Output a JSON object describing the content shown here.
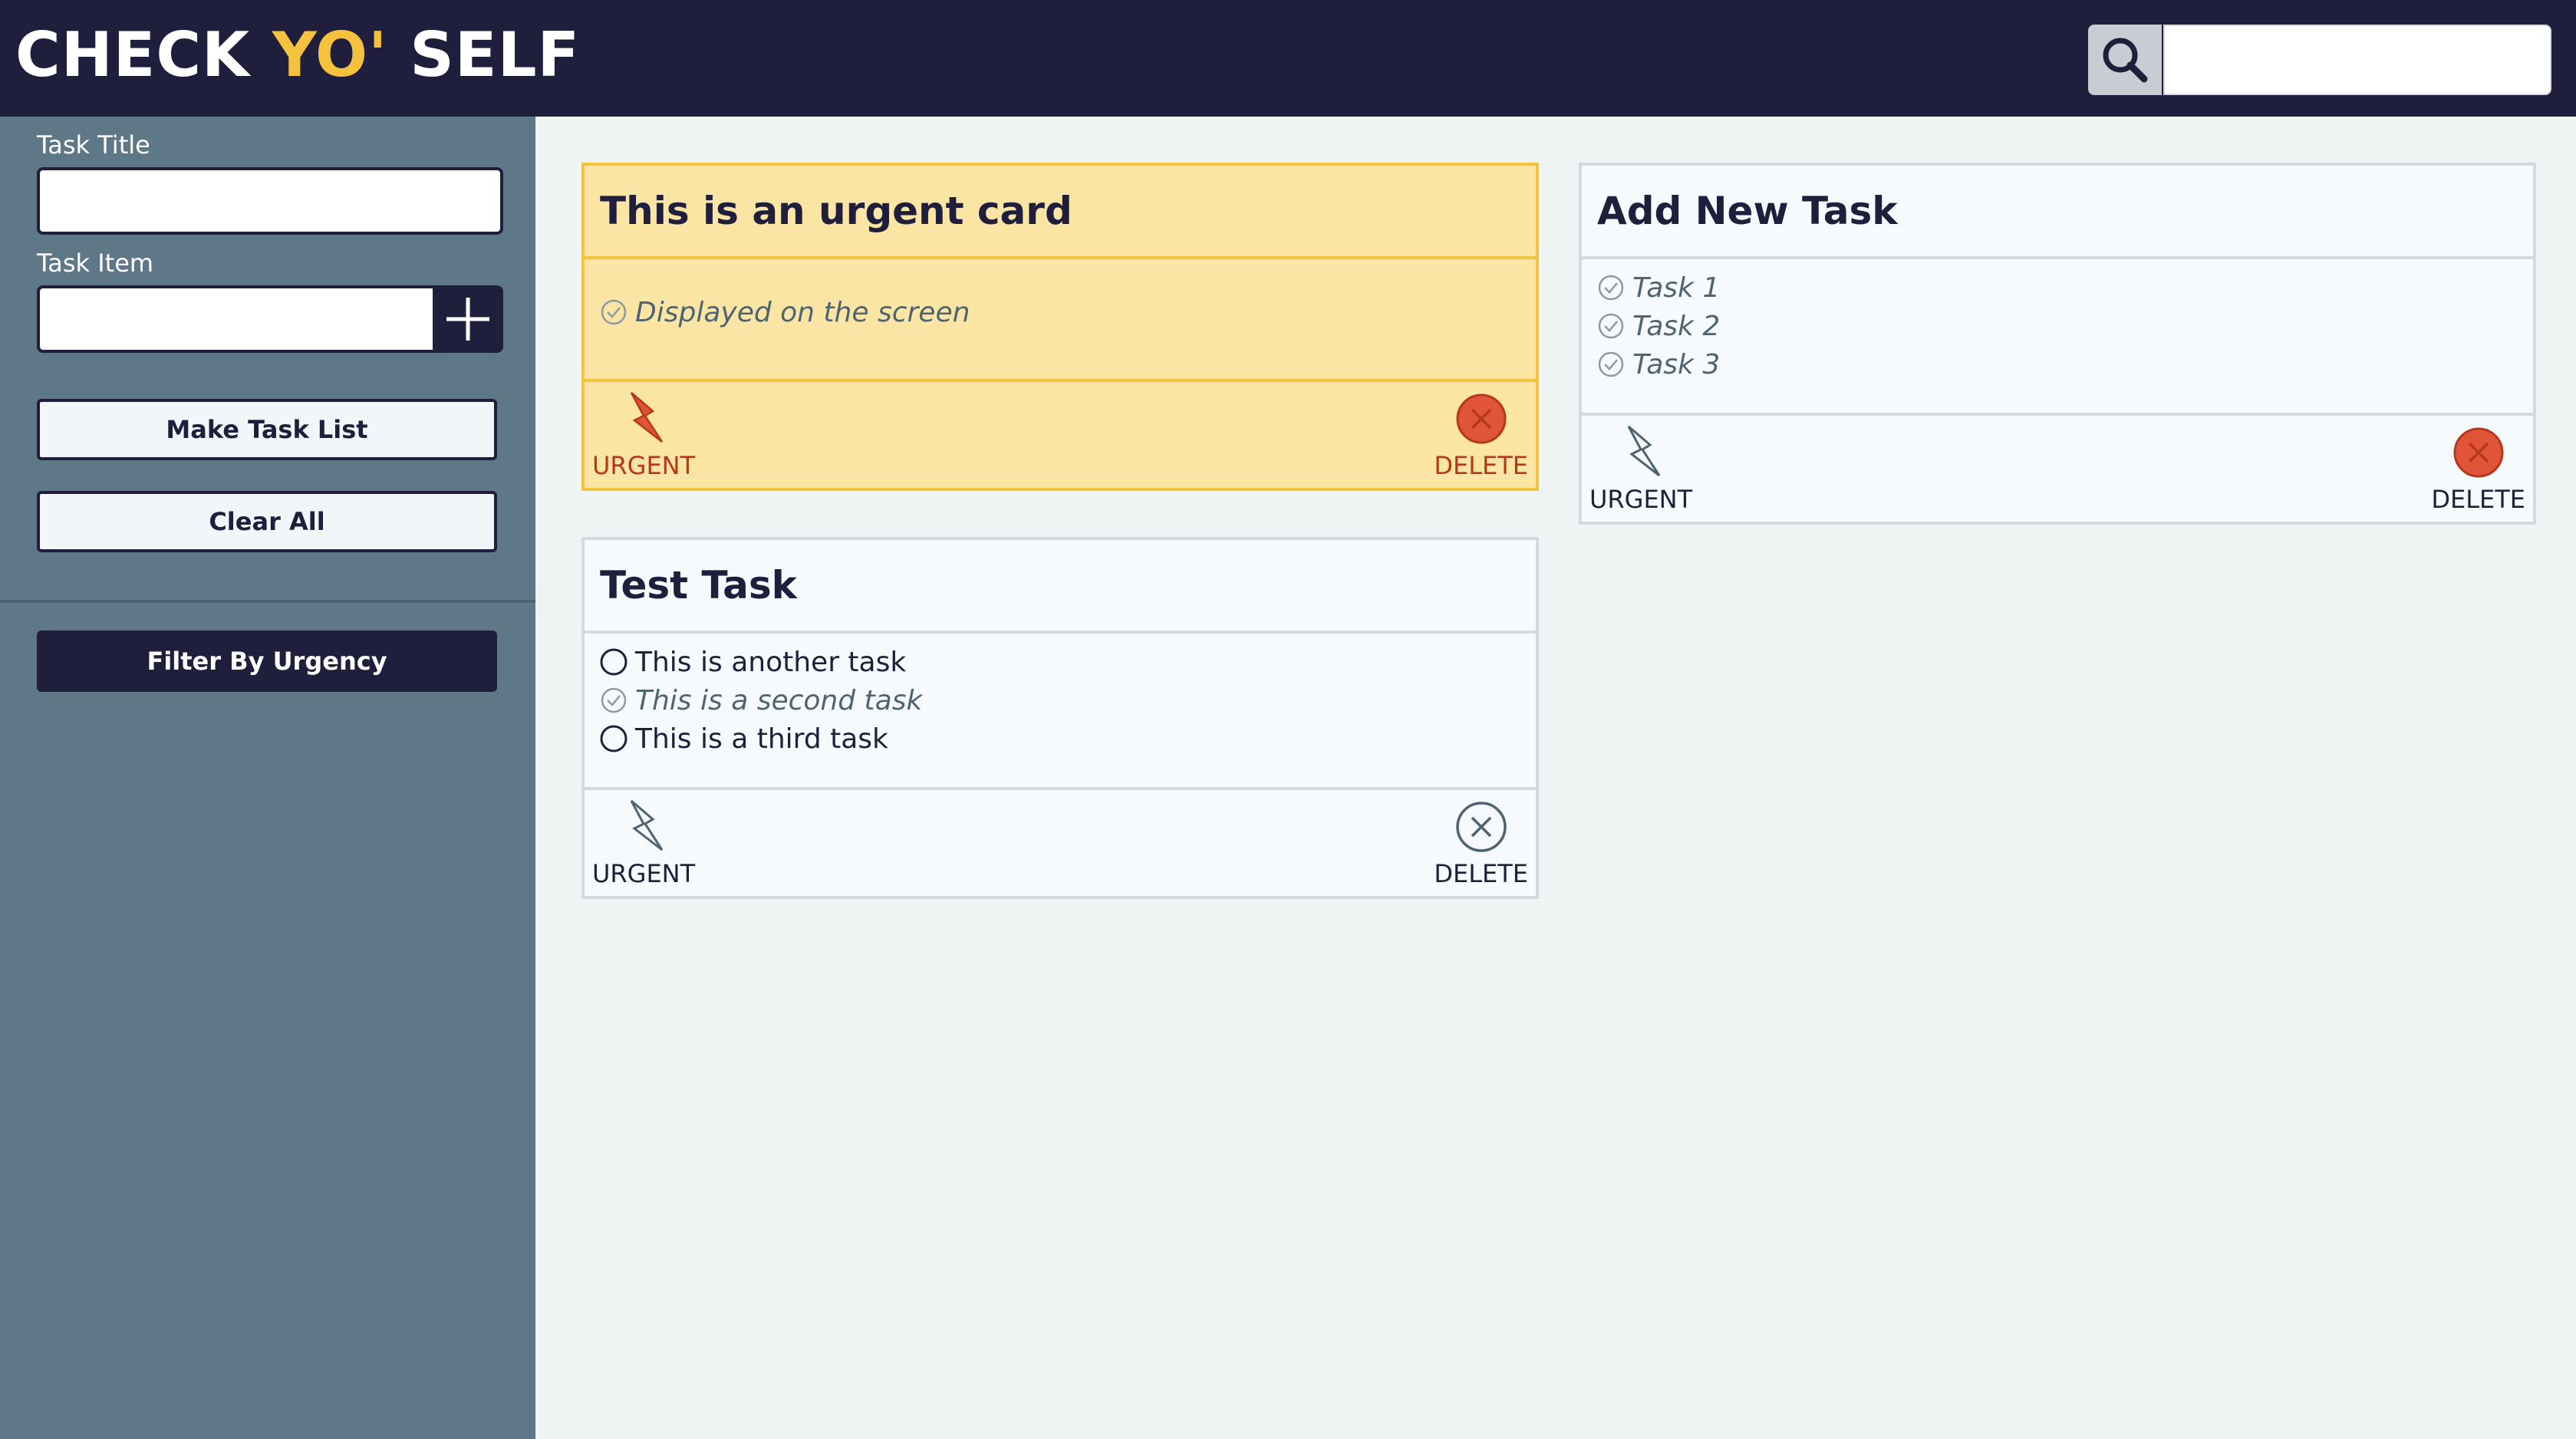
{
  "header": {
    "logo_part1": "CHECK ",
    "logo_part2": "YO'",
    "logo_part3": " SELF",
    "search_placeholder": ""
  },
  "sidebar": {
    "task_title_label": "Task Title",
    "task_title_value": "",
    "task_item_label": "Task Item",
    "task_item_value": "",
    "make_list_label": "Make Task List",
    "clear_all_label": "Clear All",
    "filter_label": "Filter By Urgency"
  },
  "cards": [
    {
      "title": "This is an urgent card",
      "urgent": true,
      "tasks": [
        {
          "text": "Displayed on the screen",
          "done": true
        }
      ],
      "urgent_label": "URGENT",
      "delete_label": "DELETE"
    },
    {
      "title": "Test Task",
      "urgent": false,
      "tasks": [
        {
          "text": "This is another task",
          "done": false
        },
        {
          "text": "This is a second task",
          "done": true
        },
        {
          "text": "This is a third task",
          "done": false
        }
      ],
      "urgent_label": "URGENT",
      "delete_label": "DELETE"
    },
    {
      "title": "Add New Task",
      "urgent": false,
      "tasks": [
        {
          "text": "Task 1",
          "done": true
        },
        {
          "text": "Task 2",
          "done": true
        },
        {
          "text": "Task 3",
          "done": true
        }
      ],
      "urgent_label": "URGENT",
      "delete_label": "DELETE"
    }
  ],
  "colors": {
    "navy": "#1f1f3d",
    "accent_yellow": "#f5c23e",
    "urgent_bg": "#fae5a5",
    "urgent_red": "#e0543a",
    "sidebar_bg": "#5f7887"
  }
}
